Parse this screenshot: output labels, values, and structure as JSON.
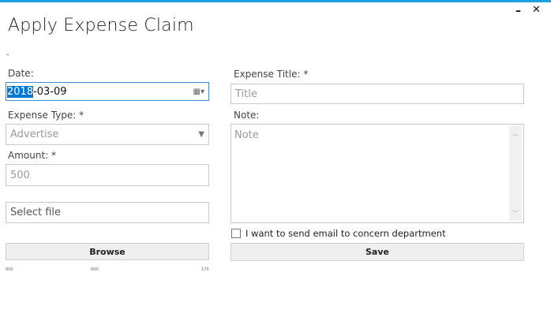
{
  "window": {
    "title": "Apply Expense Claim",
    "minimize": "–",
    "close": "✕",
    "dot": "-"
  },
  "form": {
    "date_label": "Date:",
    "date_selected": "2018",
    "date_rest": "-03-09",
    "expense_type_label": "Expense Type: *",
    "expense_type_value": "Advertise",
    "amount_label": "Amount: *",
    "amount_value": "500",
    "file_placeholder": "Select file",
    "browse_label": "Browse",
    "expense_title_label": "Expense Title: *",
    "title_placeholder": "Title",
    "note_label": "Note:",
    "note_placeholder": "Note",
    "email_checkbox_label": "I want to send email to concern department",
    "email_checked": false,
    "save_label": "Save"
  },
  "footer": {
    "left": "000",
    "middle": "000",
    "right": "170"
  },
  "colors": {
    "accent": "#1ba1e2",
    "selection": "#0078d7"
  }
}
